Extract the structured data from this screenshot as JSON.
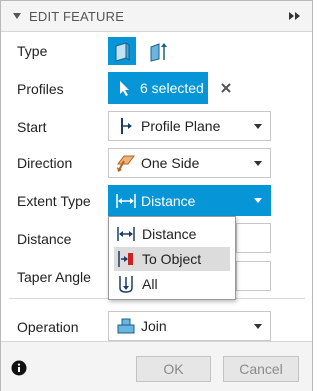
{
  "panel": {
    "title": "EDIT FEATURE"
  },
  "labels": {
    "type": "Type",
    "profiles": "Profiles",
    "start": "Start",
    "direction": "Direction",
    "extent_type": "Extent Type",
    "distance": "Distance",
    "taper_angle": "Taper Angle",
    "operation": "Operation"
  },
  "profiles": {
    "selection_label": "6 selected"
  },
  "start": {
    "value": "Profile Plane"
  },
  "direction": {
    "value": "One Side"
  },
  "extent_type": {
    "value": "Distance",
    "options": [
      {
        "label": "Distance"
      },
      {
        "label": "To Object"
      },
      {
        "label": "All"
      }
    ],
    "hovered_option": "To Object"
  },
  "operation": {
    "value": "Join"
  },
  "footer": {
    "ok_label": "OK",
    "cancel_label": "Cancel"
  },
  "colors": {
    "accent": "#0696d7",
    "icon_red": "#cc2222",
    "icon_orange": "#e58a3c"
  },
  "icons": [
    "collapse-triangle-icon",
    "expand-arrows-icon",
    "solid-extrude-icon",
    "thin-extrude-icon",
    "cursor-icon",
    "close-icon",
    "start-plane-icon",
    "direction-icon",
    "distance-icon",
    "to-object-icon",
    "all-icon",
    "join-icon",
    "info-icon"
  ]
}
